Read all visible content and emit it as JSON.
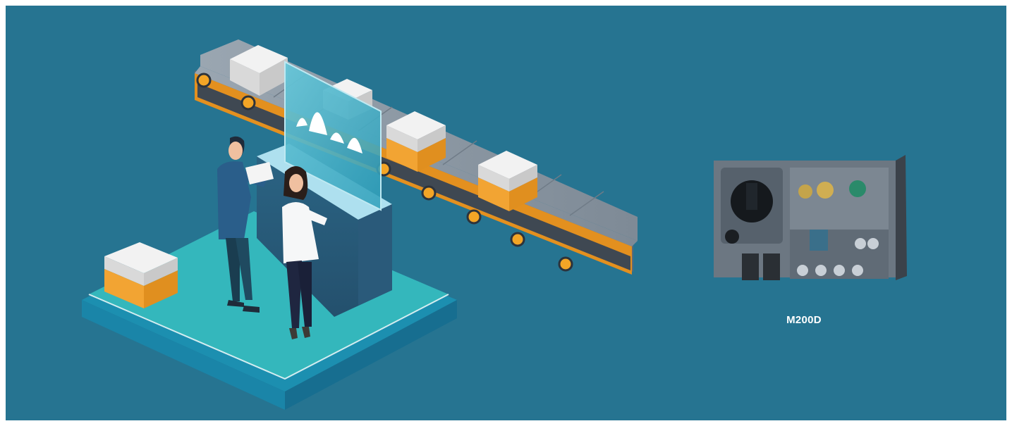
{
  "product": {
    "name": "M200D"
  },
  "colors": {
    "background": "#267491",
    "platform_top": "#33b6bd",
    "platform_side": "#1f9db3",
    "box_orange": "#f2a433",
    "box_white": "#e8e8e8",
    "conveyor_belt": "#8d99a6",
    "device_body": "#6c7782"
  },
  "illustration": {
    "chart_icon": "mountain-chart-icon",
    "people": [
      "man-figure",
      "woman-figure"
    ]
  }
}
